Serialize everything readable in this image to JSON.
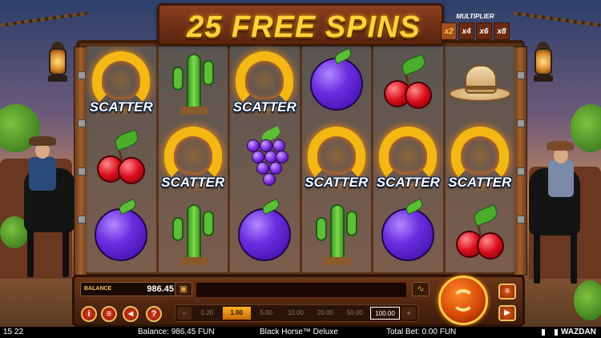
{
  "title": "25 FREE SPINS",
  "multiplier": {
    "label": "MULTIPLIER",
    "values": [
      "x2",
      "x4",
      "x6",
      "x8"
    ],
    "active_index": 0
  },
  "scatter_label": "SCATTER",
  "reels": [
    [
      "horseshoe-scatter",
      "cherry",
      "plum"
    ],
    [
      "cactus",
      "horseshoe-scatter",
      "cactus"
    ],
    [
      "horseshoe-scatter",
      "grapes",
      "plum"
    ],
    [
      "plum",
      "horseshoe-scatter",
      "cactus"
    ],
    [
      "cherry",
      "horseshoe-scatter",
      "plum"
    ],
    [
      "cowboy-hat",
      "horseshoe-scatter",
      "cherry"
    ]
  ],
  "balance": {
    "label": "BALANCE",
    "value": "986.45"
  },
  "bet_options": [
    "0.20",
    "1.00",
    "5.00",
    "10.00",
    "20.00",
    "50.00",
    "100.00"
  ],
  "bet_active": "1.00",
  "status_bar": {
    "time": "15 22",
    "balance": "Balance: 986.45 FUN",
    "game_name": "Black Horse™ Deluxe",
    "total_bet": "Total Bet: 0.00 FUN",
    "brand": "WAZDAN"
  },
  "colors": {
    "title_gold": "#ffd23a",
    "frame_wood": "#5a3018",
    "spin_orange": "#d84a06",
    "bet_active": "#ffb02a"
  },
  "icons": {
    "info": "info-icon",
    "menu": "menu-icon",
    "sound": "sound-icon",
    "help": "help-icon",
    "spin": "spin-arrows-icon",
    "autoplay": "autoplay-icon",
    "play": "play-icon"
  }
}
